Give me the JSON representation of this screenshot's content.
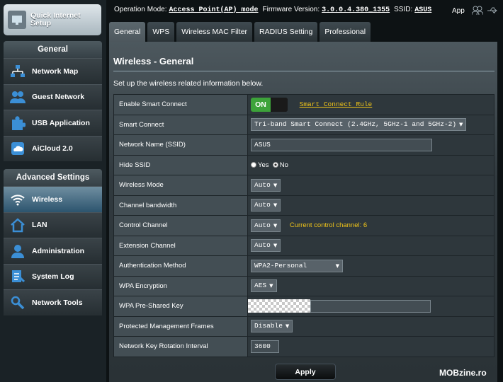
{
  "sidebar": {
    "qis_label": "Quick Internet Setup",
    "general_header": "General",
    "general_items": [
      "Network Map",
      "Guest Network",
      "USB Application",
      "AiCloud 2.0"
    ],
    "advanced_header": "Advanced Settings",
    "advanced_items": [
      "Wireless",
      "LAN",
      "Administration",
      "System Log",
      "Network Tools"
    ],
    "active_item": "Wireless"
  },
  "topbar": {
    "operation_mode_label": "Operation Mode:",
    "operation_mode_value": "Access Point(AP) mode",
    "firmware_label": "Firmware Version:",
    "firmware_value": "3.0.0.4.380_1355",
    "ssid_label": "SSID:",
    "ssid_value": "ASUS",
    "app_label": "App"
  },
  "tabs": [
    "General",
    "WPS",
    "Wireless MAC Filter",
    "RADIUS Setting",
    "Professional"
  ],
  "active_tab": "General",
  "panel": {
    "title": "Wireless - General",
    "description": "Set up the wireless related information below."
  },
  "form": {
    "smart_connect": {
      "label": "Enable Smart Connect",
      "toggle": "ON",
      "link": "Smart Connect Rule"
    },
    "smart_connect_mode": {
      "label": "Smart Connect",
      "value": "Tri-band Smart Connect (2.4GHz, 5GHz-1 and 5GHz-2)"
    },
    "ssid": {
      "label": "Network Name (SSID)",
      "value": "ASUS"
    },
    "hide_ssid": {
      "label": "Hide SSID",
      "yes": "Yes",
      "no": "No"
    },
    "wireless_mode": {
      "label": "Wireless Mode",
      "value": "Auto"
    },
    "channel_bandwidth": {
      "label": "Channel bandwidth",
      "value": "Auto"
    },
    "control_channel": {
      "label": "Control Channel",
      "value": "Auto",
      "info": "Current control channel: 6"
    },
    "extension_channel": {
      "label": "Extension Channel",
      "value": "Auto"
    },
    "auth_method": {
      "label": "Authentication Method",
      "value": "WPA2-Personal"
    },
    "wpa_encryption": {
      "label": "WPA Encryption",
      "value": "AES"
    },
    "psk": {
      "label": "WPA Pre-Shared Key"
    },
    "pmf": {
      "label": "Protected Management Frames",
      "value": "Disable"
    },
    "key_rotation": {
      "label": "Network Key Rotation Interval",
      "value": "3600"
    }
  },
  "apply_label": "Apply",
  "watermark": "MOBzine.ro"
}
